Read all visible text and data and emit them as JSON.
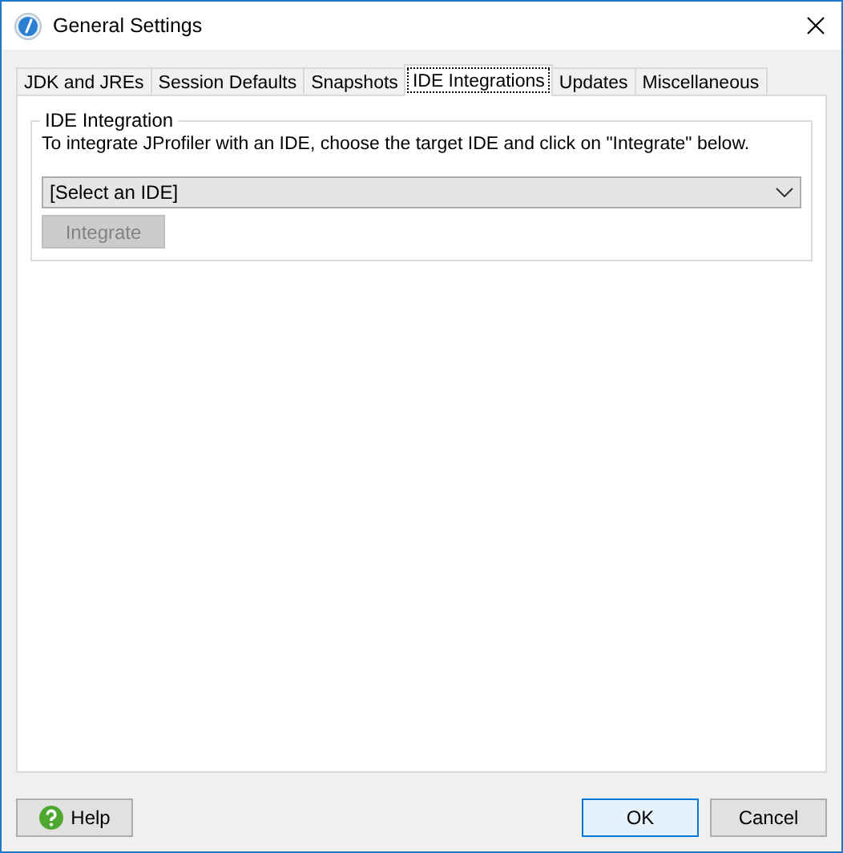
{
  "window": {
    "title": "General Settings"
  },
  "tabs": [
    {
      "label": "JDK and JREs",
      "selected": false
    },
    {
      "label": "Session Defaults",
      "selected": false
    },
    {
      "label": "Snapshots",
      "selected": false
    },
    {
      "label": "IDE Integrations",
      "selected": true
    },
    {
      "label": "Updates",
      "selected": false
    },
    {
      "label": "Miscellaneous",
      "selected": false
    }
  ],
  "group": {
    "title": "IDE Integration",
    "description": "To integrate JProfiler with an IDE, choose the target IDE and click on \"Integrate\" below.",
    "ide_select": {
      "value": "[Select an IDE]"
    },
    "integrate_button": {
      "label": "Integrate",
      "disabled": true
    }
  },
  "footer": {
    "help_button": "Help",
    "ok_button": "OK",
    "cancel_button": "Cancel"
  }
}
